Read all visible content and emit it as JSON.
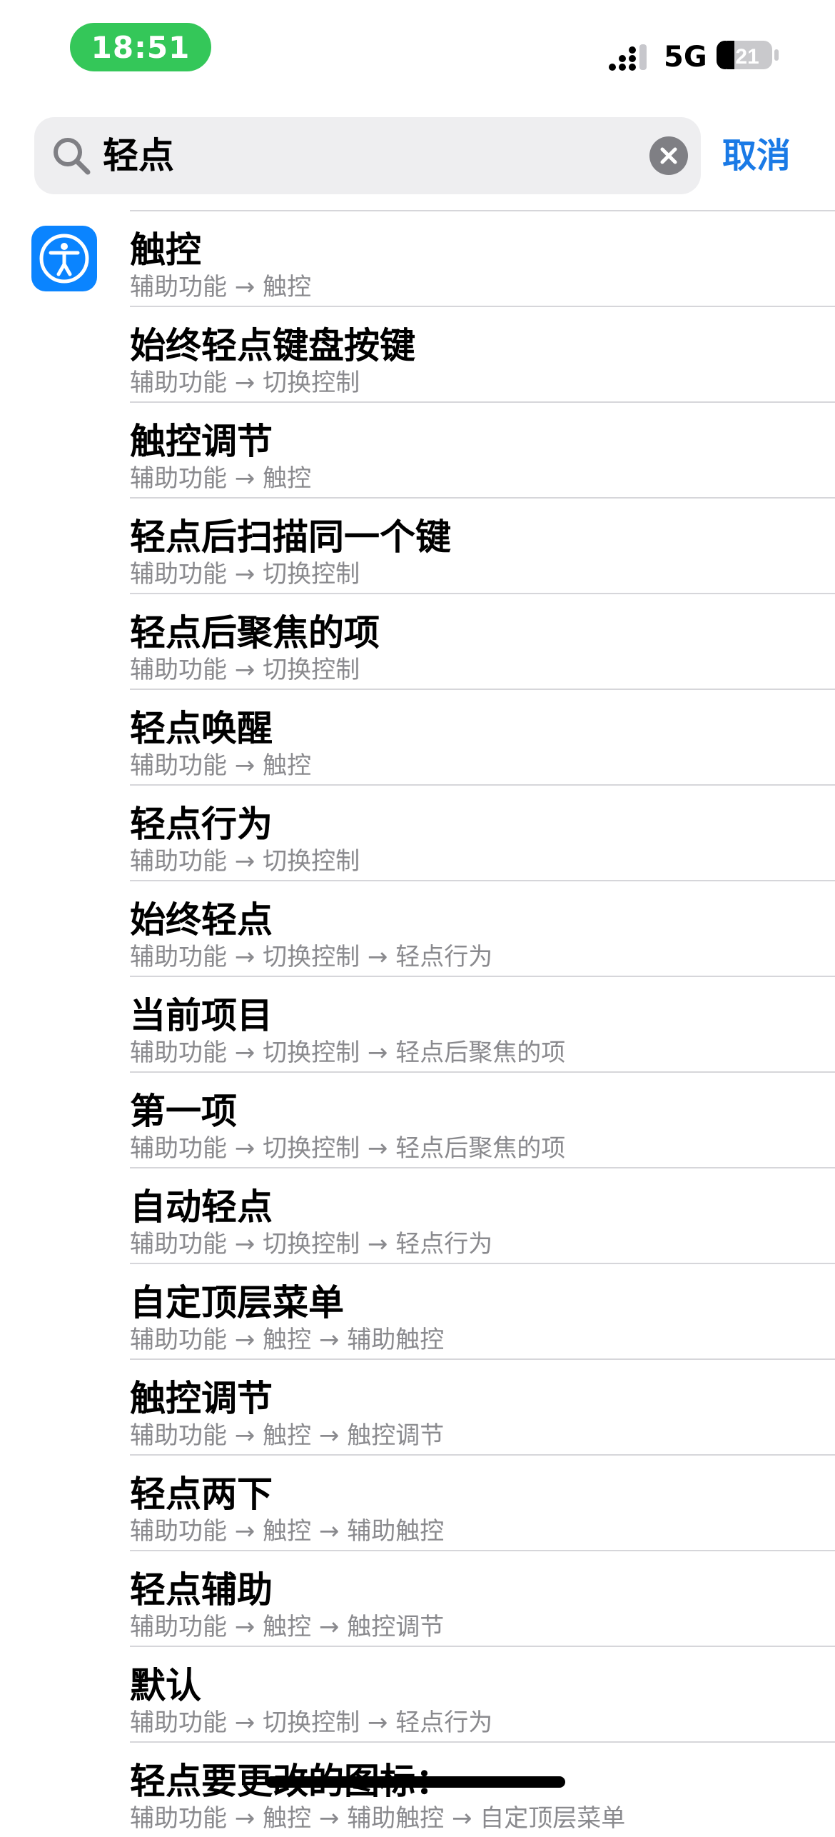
{
  "status_bar": {
    "time": "18:51",
    "network": "5G",
    "battery": "21"
  },
  "search": {
    "query": "轻点",
    "cancel_label": "取消"
  },
  "results": [
    {
      "title": "触控",
      "path": "辅助功能 → 触控"
    },
    {
      "title": "始终轻点键盘按键",
      "path": "辅助功能 → 切换控制"
    },
    {
      "title": "触控调节",
      "path": "辅助功能 → 触控"
    },
    {
      "title": "轻点后扫描同一个键",
      "path": "辅助功能 → 切换控制"
    },
    {
      "title": "轻点后聚焦的项",
      "path": "辅助功能 → 切换控制"
    },
    {
      "title": "轻点唤醒",
      "path": "辅助功能 → 触控"
    },
    {
      "title": "轻点行为",
      "path": "辅助功能 → 切换控制"
    },
    {
      "title": "始终轻点",
      "path": "辅助功能 → 切换控制 → 轻点行为"
    },
    {
      "title": "当前项目",
      "path": "辅助功能 → 切换控制 → 轻点后聚焦的项"
    },
    {
      "title": "第一项",
      "path": "辅助功能 → 切换控制 → 轻点后聚焦的项"
    },
    {
      "title": "自动轻点",
      "path": "辅助功能 → 切换控制 → 轻点行为"
    },
    {
      "title": "自定顶层菜单",
      "path": "辅助功能 → 触控 → 辅助触控"
    },
    {
      "title": "触控调节",
      "path": "辅助功能 → 触控 → 触控调节"
    },
    {
      "title": "轻点两下",
      "path": "辅助功能 → 触控 → 辅助触控"
    },
    {
      "title": "轻点辅助",
      "path": "辅助功能 → 触控 → 触控调节"
    },
    {
      "title": "默认",
      "path": "辅助功能 → 切换控制 → 轻点行为"
    },
    {
      "title": "轻点要更改的图标：",
      "path": "辅助功能 → 触控 → 辅助触控 → 自定顶层菜单"
    }
  ],
  "colors": {
    "accent": "#1a7ae6",
    "time_pill": "#34c759",
    "icon_bg": "#0a84ff"
  },
  "icons": [
    "search-icon",
    "clear-icon",
    "accessibility-icon",
    "signal-icon",
    "battery-icon"
  ]
}
